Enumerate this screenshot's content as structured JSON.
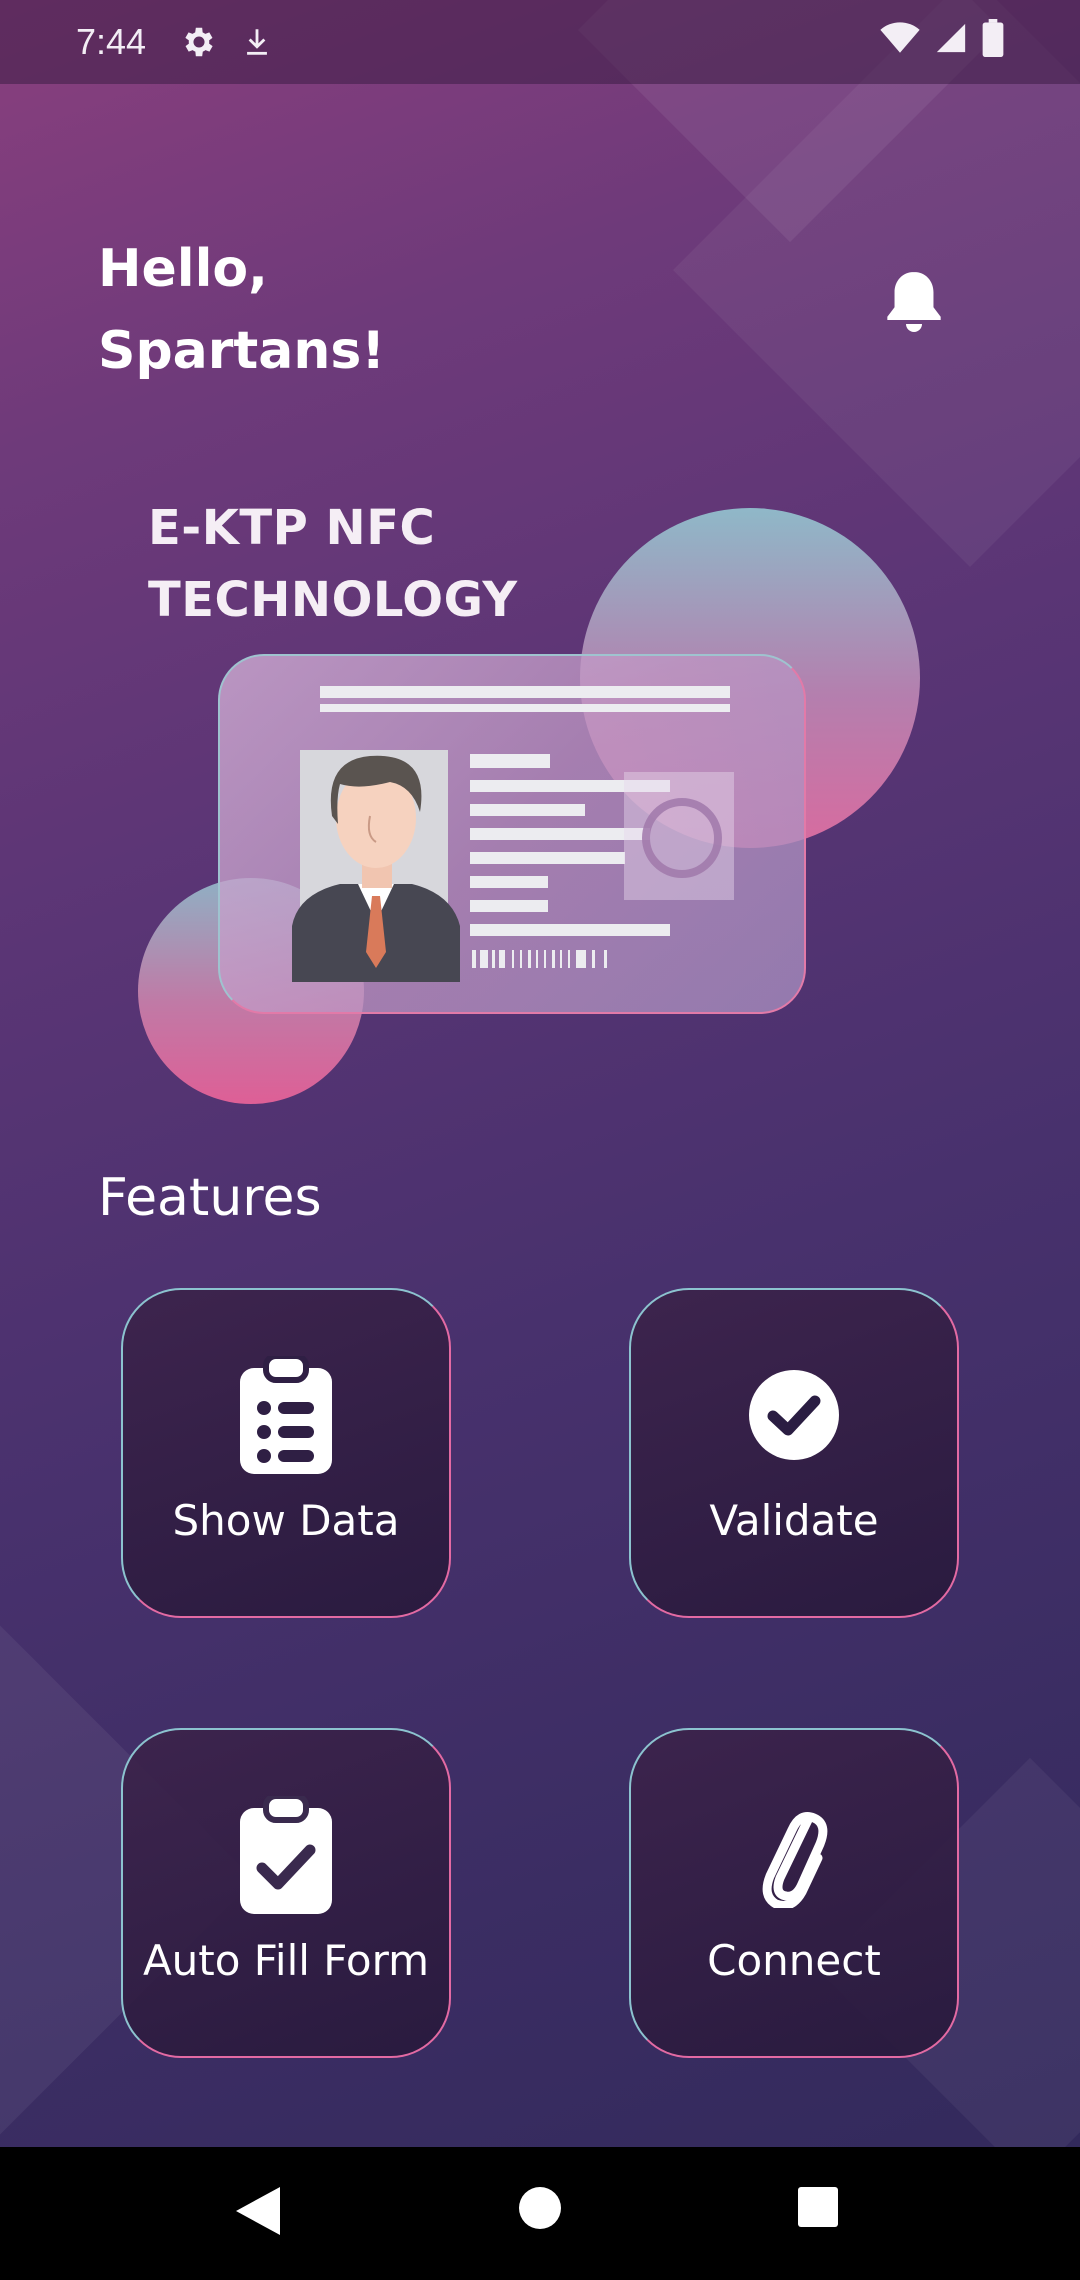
{
  "status_bar": {
    "time": "7:44",
    "left_icons": [
      "settings-icon",
      "download-icon"
    ],
    "right_icons": [
      "wifi-icon",
      "cellular-signal-icon",
      "battery-icon"
    ]
  },
  "header": {
    "greeting_line1": "Hello,",
    "greeting_line2": "Spartans!",
    "notification_icon": "bell-icon"
  },
  "hero": {
    "title_line1": "E-KTP NFC",
    "title_line2": "TECHNOLOGY",
    "illustration": "id-card-illustration"
  },
  "features": {
    "title": "Features",
    "items": [
      {
        "label": "Show Data",
        "icon": "clipboard-list-icon"
      },
      {
        "label": "Validate",
        "icon": "check-circle-icon"
      },
      {
        "label": "Auto Fill Form",
        "icon": "clipboard-check-icon"
      },
      {
        "label": "Connect",
        "icon": "paperclip-icon"
      }
    ]
  },
  "nav_bar": {
    "buttons": [
      "back-icon",
      "home-icon",
      "recents-icon"
    ]
  },
  "colors": {
    "background_top": "#8a3f7e",
    "background_bottom": "#332a5c",
    "tile_border_start": "#8cc3cf",
    "tile_border_end": "#e36aa3"
  }
}
